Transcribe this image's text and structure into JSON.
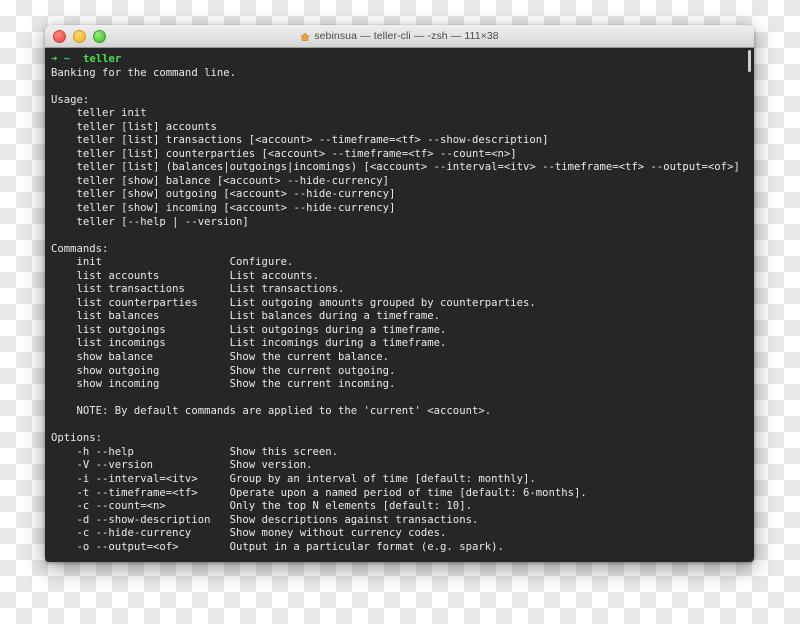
{
  "window": {
    "title": "sebinsua — teller-cli — -zsh — 111×38",
    "home_icon": "home-icon",
    "traffic_lights": {
      "close_label": "close",
      "minimize_label": "minimize",
      "maximize_label": "maximize",
      "close_color": "#f5564a",
      "minimize_color": "#f7bd2e",
      "maximize_color": "#4ccc32"
    }
  },
  "terminal": {
    "background_color": "#262626",
    "foreground_color": "#e9e9e9",
    "prompt": {
      "arrow": "➜",
      "arrow_color": "#3ddd4a",
      "cwd": "~",
      "cwd_color": "#2fbcc4",
      "command": "teller",
      "command_color": "#4ade55"
    },
    "tagline": "Banking for the command line.",
    "usage": {
      "heading": "Usage:",
      "lines": [
        "teller init",
        "teller [list] accounts",
        "teller [list] transactions [<account> --timeframe=<tf> --show-description]",
        "teller [list] counterparties [<account> --timeframe=<tf> --count=<n>]",
        "teller [list] (balances|outgoings|incomings) [<account> --interval=<itv> --timeframe=<tf> --output=<of>]",
        "teller [show] balance [<account> --hide-currency]",
        "teller [show] outgoing [<account> --hide-currency]",
        "teller [show] incoming [<account> --hide-currency]",
        "teller [--help | --version]"
      ]
    },
    "commands": {
      "heading": "Commands:",
      "items": [
        {
          "name": "init",
          "description": "Configure."
        },
        {
          "name": "list accounts",
          "description": "List accounts."
        },
        {
          "name": "list transactions",
          "description": "List transactions."
        },
        {
          "name": "list counterparties",
          "description": "List outgoing amounts grouped by counterparties."
        },
        {
          "name": "list balances",
          "description": "List balances during a timeframe."
        },
        {
          "name": "list outgoings",
          "description": "List outgoings during a timeframe."
        },
        {
          "name": "list incomings",
          "description": "List incomings during a timeframe."
        },
        {
          "name": "show balance",
          "description": "Show the current balance."
        },
        {
          "name": "show outgoing",
          "description": "Show the current outgoing."
        },
        {
          "name": "show incoming",
          "description": "Show the current incoming."
        }
      ],
      "note": "NOTE: By default commands are applied to the 'current' <account>."
    },
    "options": {
      "heading": "Options:",
      "items": [
        {
          "flag": "-h --help",
          "description": "Show this screen."
        },
        {
          "flag": "-V --version",
          "description": "Show version."
        },
        {
          "flag": "-i --interval=<itv>",
          "description": "Group by an interval of time [default: monthly]."
        },
        {
          "flag": "-t --timeframe=<tf>",
          "description": "Operate upon a named period of time [default: 6-months]."
        },
        {
          "flag": "-c --count=<n>",
          "description": "Only the top N elements [default: 10]."
        },
        {
          "flag": "-d --show-description",
          "description": "Show descriptions against transactions."
        },
        {
          "flag": "-c --hide-currency",
          "description": "Show money without currency codes."
        },
        {
          "flag": "-o --output=<of>",
          "description": "Output in a particular format (e.g. spark)."
        }
      ]
    }
  }
}
